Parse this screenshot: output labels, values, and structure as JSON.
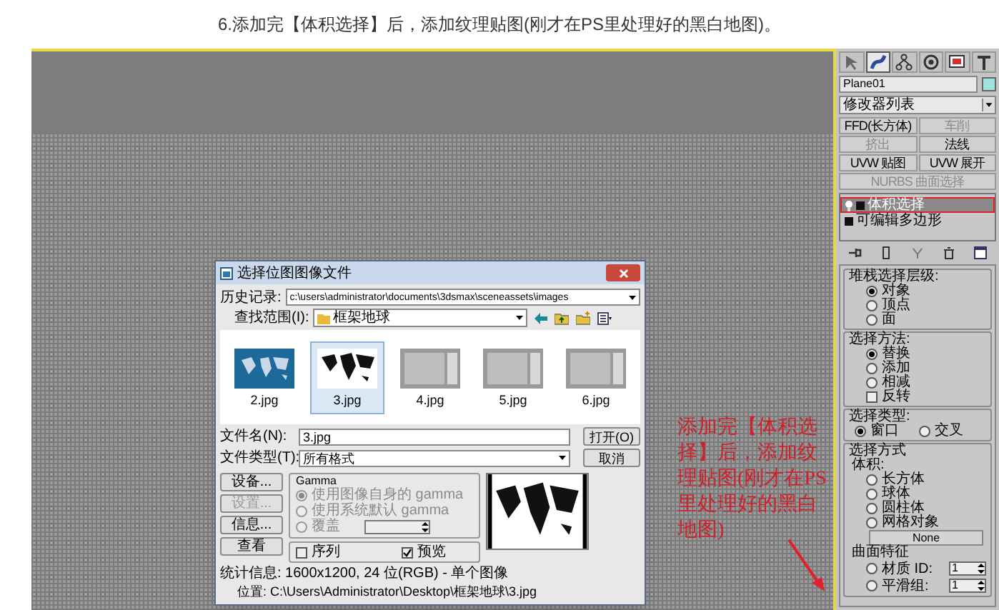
{
  "caption": "6.添加完【体积选择】后，添加纹理贴图(刚才在PS里处理好的黑白地图)。",
  "command_panel": {
    "tabs": [
      {
        "selected": false
      },
      {
        "selected": true
      },
      {
        "selected": false
      },
      {
        "selected": false
      },
      {
        "selected": false
      },
      {
        "selected": false
      }
    ],
    "object_name": "Plane01",
    "modifier_list": "修改器列表",
    "modifier_buttons": [
      {
        "label": "FFD(长方体)",
        "disabled": false
      },
      {
        "label": "车削",
        "disabled": true
      },
      {
        "label": "挤出",
        "disabled": true
      },
      {
        "label": "法线",
        "disabled": false
      },
      {
        "label": "UVW 贴图",
        "disabled": false
      },
      {
        "label": "UVW 展开",
        "disabled": false
      },
      {
        "label": "NURBS 曲面选择",
        "disabled": true
      }
    ],
    "stack": [
      {
        "label": "体积选择",
        "selected": true,
        "highlighted": true
      },
      {
        "label": "可编辑多边形",
        "selected": false,
        "highlighted": false
      }
    ],
    "groups": [
      {
        "title": "堆栈选择层级:",
        "horizontal": false,
        "options": [
          {
            "kind": "radio",
            "label": "对象",
            "selected": true
          },
          {
            "kind": "radio",
            "label": "顶点",
            "selected": false
          },
          {
            "kind": "radio",
            "label": "面",
            "selected": false
          }
        ]
      },
      {
        "title": "选择方法:",
        "horizontal": false,
        "options": [
          {
            "kind": "radio",
            "label": "替换",
            "selected": true
          },
          {
            "kind": "radio",
            "label": "添加",
            "selected": false
          },
          {
            "kind": "radio",
            "label": "相减",
            "selected": false
          },
          {
            "kind": "checkbox",
            "label": "反转",
            "checked": false
          }
        ]
      },
      {
        "title": "选择类型:",
        "horizontal": true,
        "options": [
          {
            "kind": "radio",
            "label": "窗口",
            "selected": true
          },
          {
            "kind": "radio",
            "label": "交叉",
            "selected": false
          }
        ]
      },
      {
        "title": "选择方式",
        "horizontal": false,
        "options": [
          {
            "kind": "heading",
            "label": "体积:"
          },
          {
            "kind": "radio",
            "label": "长方体",
            "selected": false
          },
          {
            "kind": "radio",
            "label": "球体",
            "selected": false
          },
          {
            "kind": "radio",
            "label": "圆柱体",
            "selected": false
          },
          {
            "kind": "radio",
            "label": "网格对象",
            "selected": false
          },
          {
            "kind": "button",
            "label": "None"
          },
          {
            "kind": "heading",
            "label": "曲面特征"
          },
          {
            "kind": "radio_spinner",
            "label": "材质 ID:",
            "value": "1",
            "selected": false
          },
          {
            "kind": "radio_spinner",
            "label": "平滑组:",
            "value": "1",
            "selected": false
          }
        ]
      }
    ]
  },
  "dialog": {
    "title": "选择位图图像文件",
    "history_label": "历史记录:",
    "history_path": "c:\\users\\administrator\\documents\\3dsmax\\sceneassets\\images",
    "look_in_label": "查找范围(I):",
    "look_in_value": "框架地球",
    "thumbnails": [
      {
        "label": "2.jpg",
        "kind": "color_map",
        "selected": false
      },
      {
        "label": "3.jpg",
        "kind": "bw_map",
        "selected": true
      },
      {
        "label": "4.jpg",
        "kind": "screenshot",
        "selected": false
      },
      {
        "label": "5.jpg",
        "kind": "screenshot",
        "selected": false
      },
      {
        "label": "6.jpg",
        "kind": "screenshot",
        "selected": false
      }
    ],
    "file_name_label": "文件名(N):",
    "file_name": "3.jpg",
    "file_type_label": "文件类型(T):",
    "file_type": "所有格式",
    "open_button": "打开(O)",
    "cancel_button": "取消",
    "side_buttons": [
      {
        "label": "设备...",
        "disabled": false
      },
      {
        "label": "设置...",
        "disabled": true
      },
      {
        "label": "信息...",
        "disabled": false
      },
      {
        "label": "查看",
        "disabled": false
      }
    ],
    "gamma_title": "Gamma",
    "gamma_options": [
      {
        "label": "使用图像自身的 gamma",
        "selected": true,
        "disabled": true
      },
      {
        "label": "使用系统默认 gamma",
        "selected": false,
        "disabled": true
      },
      {
        "label": "覆盖",
        "selected": false,
        "disabled": true
      }
    ],
    "sequence": {
      "label": "序列",
      "checked": false
    },
    "preview": {
      "label": "预览",
      "checked": true
    },
    "stats": "统计信息: 1600x1200, 24 位(RGB) - 单个图像",
    "location": "位置: C:\\Users\\Administrator\\Desktop\\框架地球\\3.jpg"
  },
  "annotation": "添加完【体积选择】后，添加纹理贴图(刚才在PS里处理好的黑白地图)"
}
